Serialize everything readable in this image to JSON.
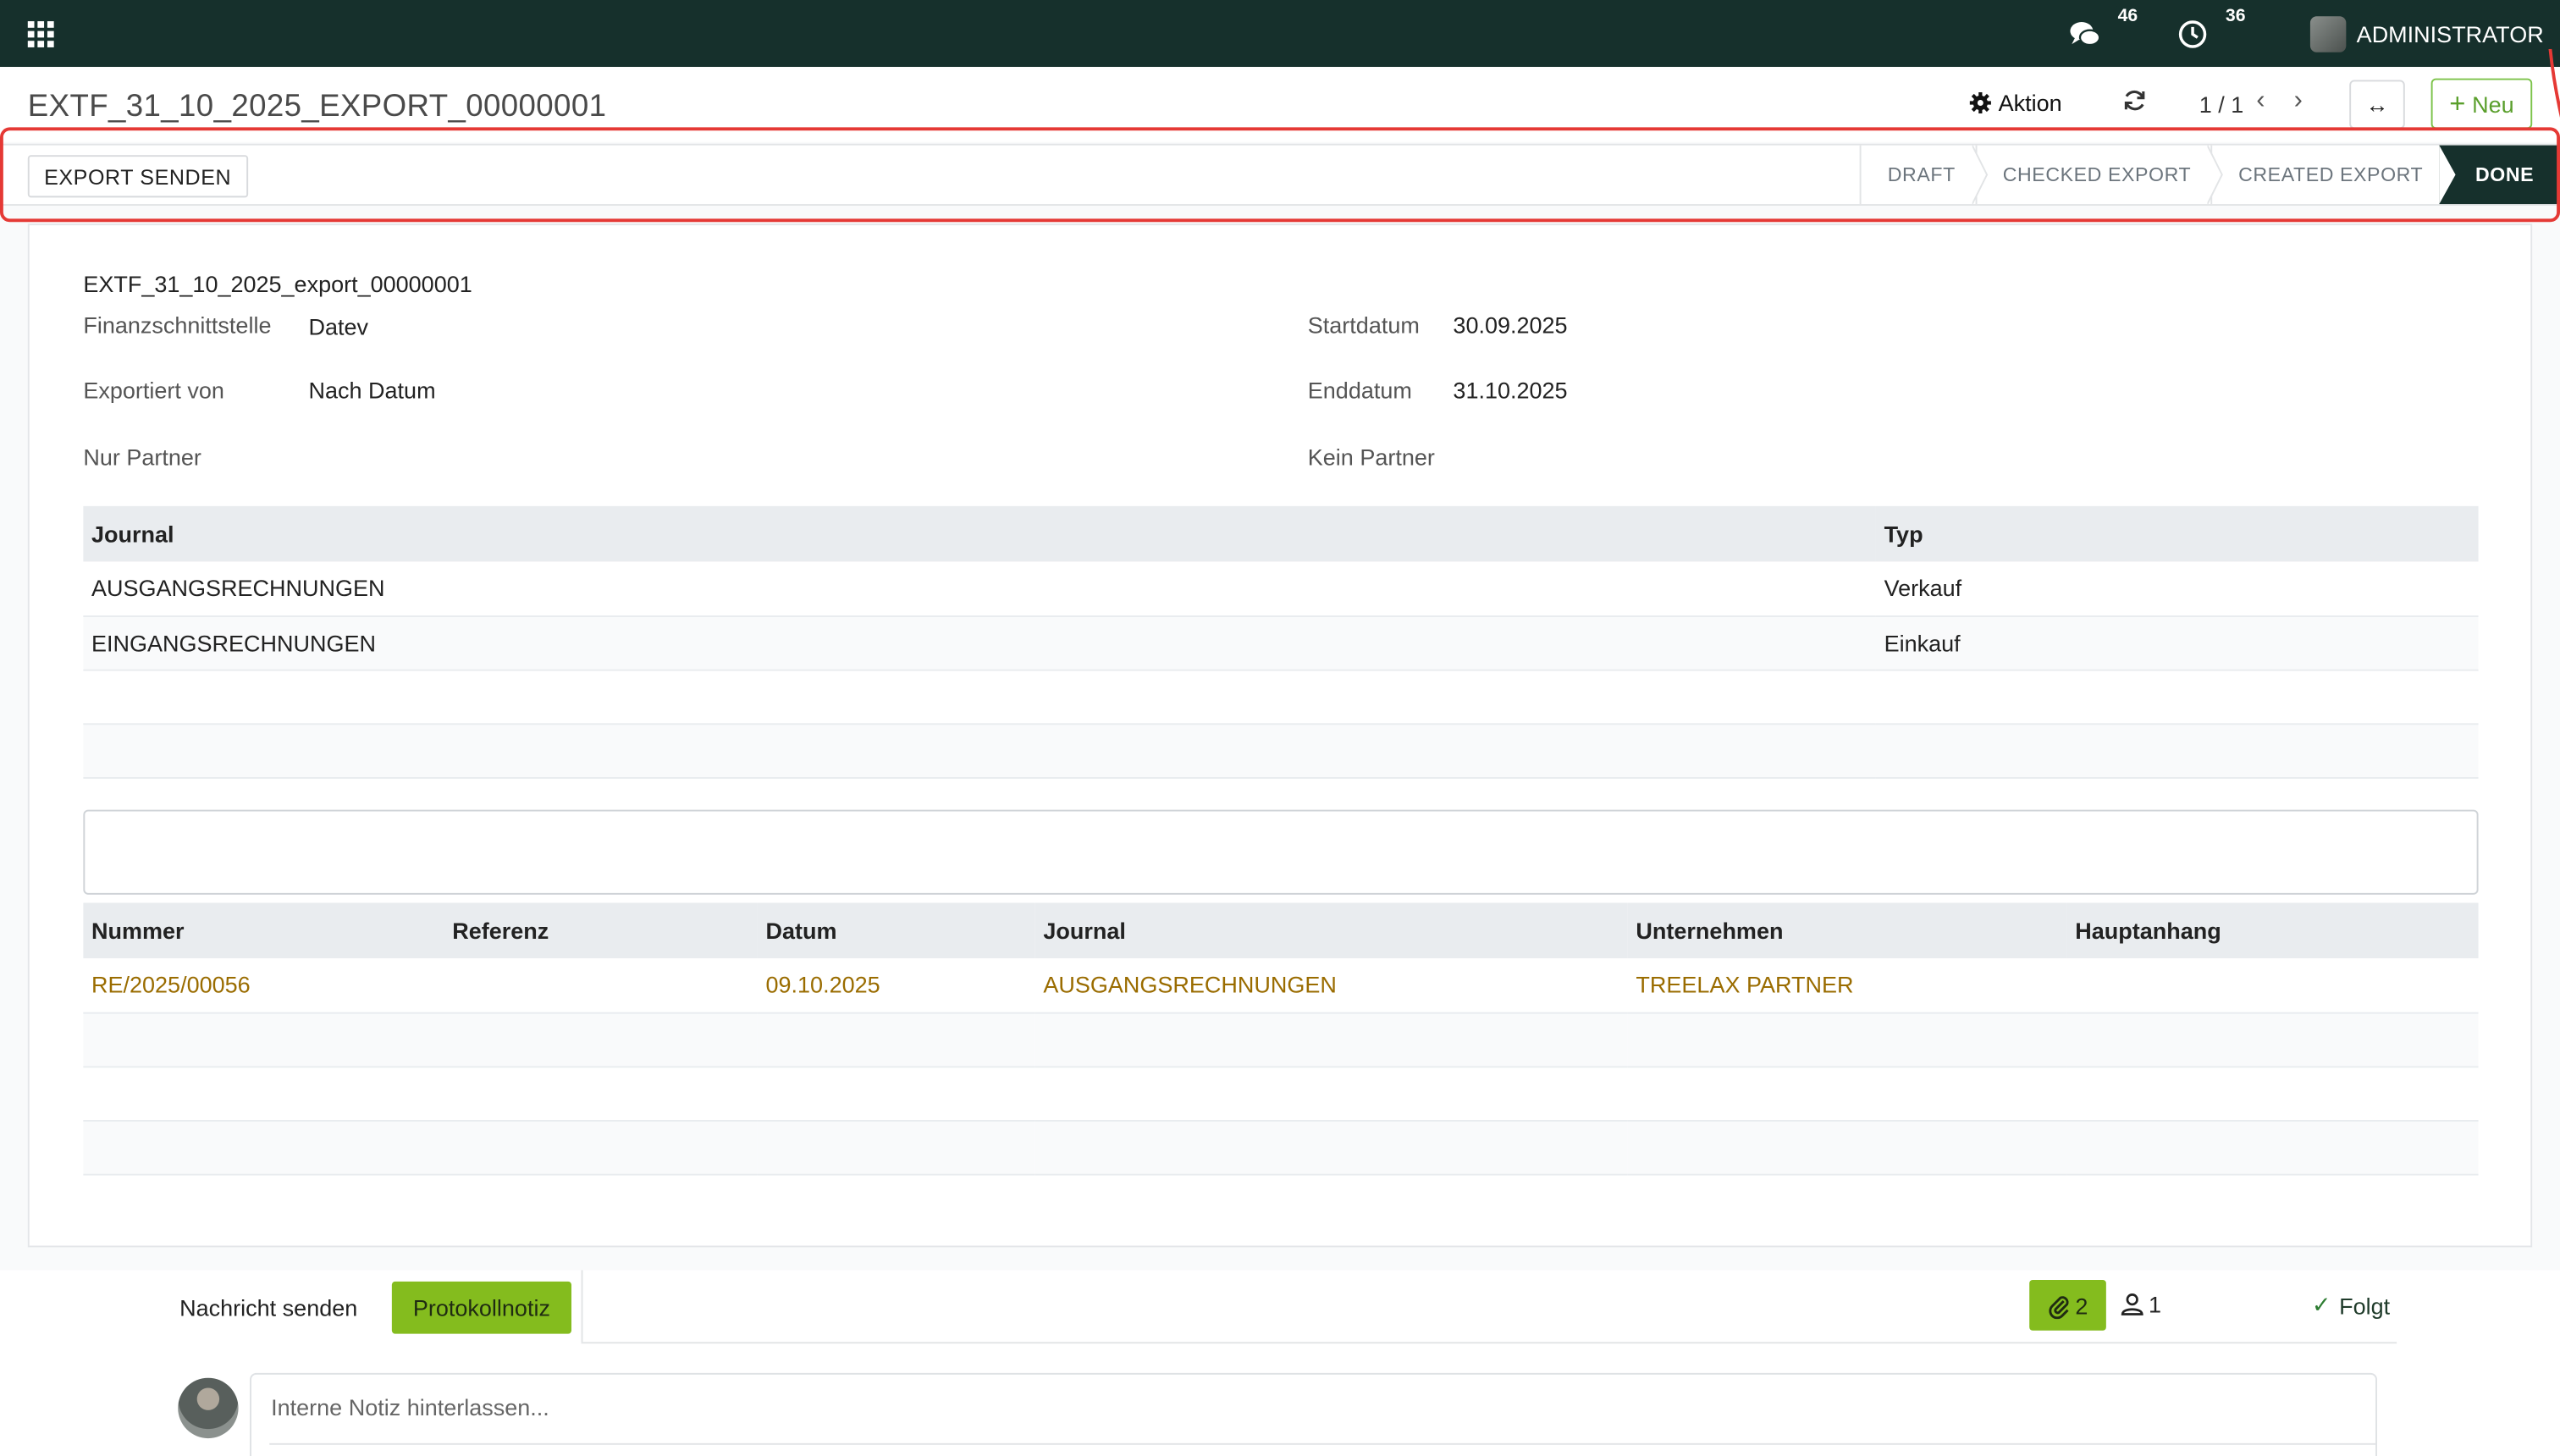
{
  "navbar": {
    "messages_count": "46",
    "activities_count": "36",
    "user_name": "ADMINISTRATOR",
    "icons": [
      "apps-grid-icon",
      "chat-icon",
      "clock-icon"
    ]
  },
  "control_panel": {
    "title": "EXTF_31_10_2025_EXPORT_00000001",
    "action_label": "Aktion",
    "pager": "1 / 1",
    "new_label": "Neu"
  },
  "statusbar": {
    "button_label": "EXPORT SENDEN",
    "stages": [
      "DRAFT",
      "CHECKED EXPORT",
      "CREATED EXPORT",
      "DONE"
    ],
    "active_stage": "DONE",
    "highlight_color": "#e53935"
  },
  "form": {
    "name": "EXTF_31_10_2025_export_00000001",
    "finanzschnittstelle_label": "Finanzschnittstelle",
    "finanzschnittstelle_value": "Datev",
    "exportiert_von_label": "Exportiert von",
    "exportiert_von_value": "Nach Datum",
    "nur_partner_label": "Nur Partner",
    "startdatum_label": "Startdatum",
    "startdatum_value": "30.09.2025",
    "enddatum_label": "Enddatum",
    "enddatum_value": "31.10.2025",
    "kein_partner_label": "Kein Partner"
  },
  "journals_table": {
    "headers": [
      "Journal",
      "Typ"
    ],
    "rows": [
      [
        "AUSGANGSRECHNUNGEN",
        "Verkauf"
      ],
      [
        "EINGANGSRECHNUNGEN",
        "Einkauf"
      ]
    ]
  },
  "moves_table": {
    "headers": [
      "Nummer",
      "Referenz",
      "Datum",
      "Journal",
      "Unternehmen",
      "Hauptanhang"
    ],
    "rows": [
      [
        "RE/2025/00056",
        "",
        "09.10.2025",
        "AUSGANGSRECHNUNGEN",
        "TREELAX PARTNER",
        ""
      ]
    ],
    "link_color": "#9a6c00"
  },
  "chatter": {
    "send_message_label": "Nachricht senden",
    "log_note_label": "Protokollnotiz",
    "attachments_count": "2",
    "followers_count": "1",
    "follow_label": "Folgt",
    "note_placeholder": "Interne Notiz hinterlassen...",
    "accent_color": "#84bc1e"
  },
  "colors": {
    "navbar_bg": "#16302c",
    "active_stage_bg": "#16302c"
  }
}
